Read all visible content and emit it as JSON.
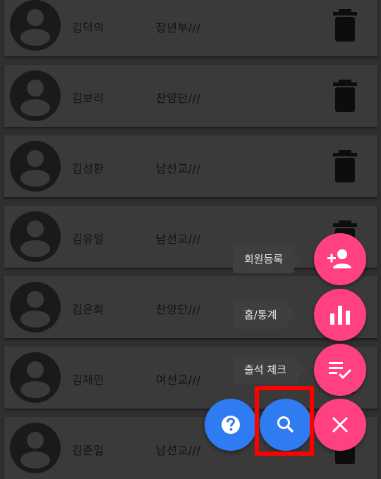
{
  "members": [
    {
      "name": "김덕의",
      "group": "장년부///"
    },
    {
      "name": "김보리",
      "group": "찬양단///"
    },
    {
      "name": "김성환",
      "group": "남선교///"
    },
    {
      "name": "김유일",
      "group": "남선교///"
    },
    {
      "name": "김은희",
      "group": "찬양단///"
    },
    {
      "name": "김재민",
      "group": "여선교///"
    },
    {
      "name": "김준일",
      "group": "남선교///"
    }
  ],
  "fab_menu": {
    "register_label": "회원등록",
    "stats_label": "홈/통계",
    "attendance_label": "출석 체크"
  },
  "icons": {
    "help": "help-icon",
    "search": "search-icon",
    "close": "close-icon",
    "add_person": "person-add-icon",
    "chart": "bar-chart-icon",
    "checklist": "playlist-check-icon",
    "trash": "trash-icon",
    "avatar": "account-circle-icon"
  },
  "colors": {
    "fab_pink": "#ff4081",
    "fab_blue": "#2f7bf1",
    "highlight": "#ff0000"
  }
}
